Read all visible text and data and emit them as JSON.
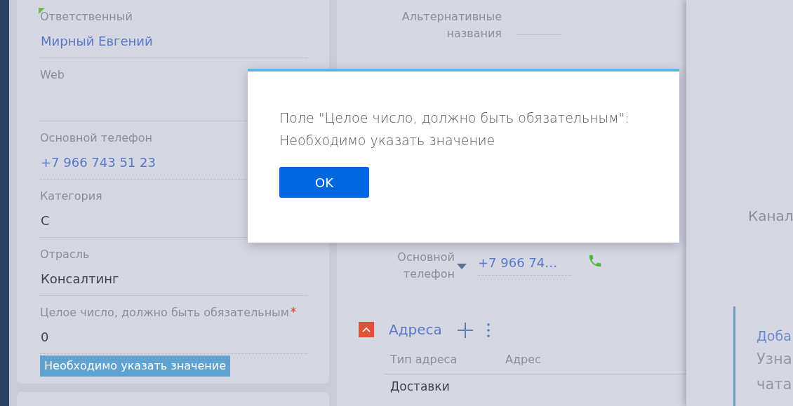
{
  "profile_fields": [
    {
      "label": "Ответственный",
      "value": "Мирный Евгений",
      "kind": "link",
      "marked": true,
      "required": false
    },
    {
      "label": "Web",
      "marked": false,
      "required": false
    },
    {
      "label": "Основной телефон",
      "value": "+7 966 743 51 23",
      "kind": "link",
      "marked": false,
      "required": false
    },
    {
      "label": "Категория",
      "value": "С",
      "kind": "text",
      "marked": false,
      "required": false
    },
    {
      "label": "Отрасль",
      "value": "Консалтинг",
      "kind": "text",
      "marked": false,
      "required": false
    },
    {
      "label": "Целое число, должно быть обязательным",
      "value": "0",
      "kind": "text",
      "marked": false,
      "required": true,
      "error": "Необходимо указать значение"
    }
  ],
  "details": {
    "alt_names_label": "Альтернативные названия",
    "phone_label": "Основной телефон",
    "phone_value": "+7 966 74…"
  },
  "addresses": {
    "title": "Адреса",
    "expanded": true,
    "columns": [
      "Тип адреса",
      "Адрес"
    ],
    "rows": [
      {
        "type": "Доставки"
      }
    ]
  },
  "side_panel": {
    "heading": "Канал",
    "tip_title": "Доба",
    "tip_lines": [
      "Узна",
      "чата"
    ]
  },
  "dialog": {
    "message_lines": [
      "Поле \"Целое число, должно быть обязательным\":",
      "Необходимо указать значение"
    ],
    "ok": "OK"
  }
}
